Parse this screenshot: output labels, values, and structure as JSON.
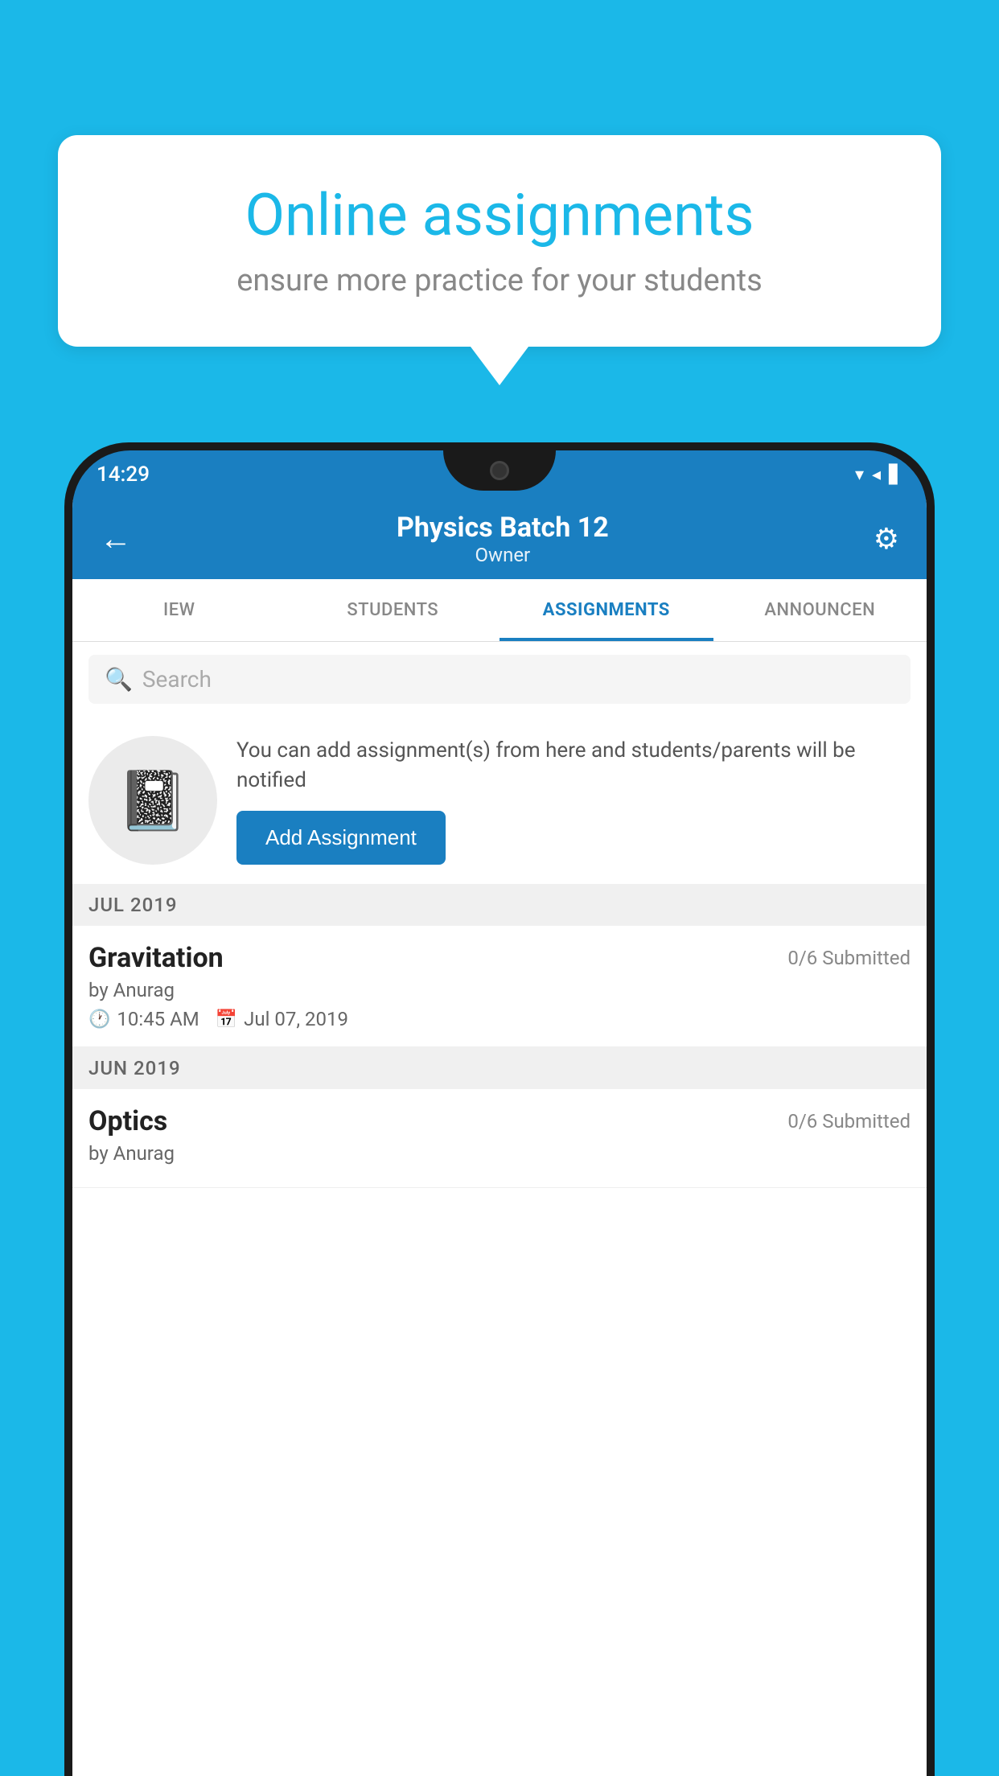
{
  "background_color": "#1BB8E8",
  "speech_bubble": {
    "title": "Online assignments",
    "subtitle": "ensure more practice for your students"
  },
  "status_bar": {
    "time": "14:29",
    "signal_icons": "▼◀█"
  },
  "app_bar": {
    "title": "Physics Batch 12",
    "subtitle": "Owner",
    "back_label": "←",
    "settings_label": "⚙"
  },
  "tabs": [
    {
      "id": "view",
      "label": "IEW",
      "active": false
    },
    {
      "id": "students",
      "label": "STUDENTS",
      "active": false
    },
    {
      "id": "assignments",
      "label": "ASSIGNMENTS",
      "active": true
    },
    {
      "id": "announcements",
      "label": "ANNOUNCEN",
      "active": false
    }
  ],
  "search": {
    "placeholder": "Search"
  },
  "info_section": {
    "description": "You can add assignment(s) from here and students/parents will be notified",
    "add_button_label": "Add Assignment"
  },
  "sections": [
    {
      "header": "JUL 2019",
      "assignments": [
        {
          "name": "Gravitation",
          "submitted": "0/6 Submitted",
          "by": "by Anurag",
          "time": "10:45 AM",
          "date": "Jul 07, 2019"
        }
      ]
    },
    {
      "header": "JUN 2019",
      "assignments": [
        {
          "name": "Optics",
          "submitted": "0/6 Submitted",
          "by": "by Anurag",
          "time": "",
          "date": ""
        }
      ]
    }
  ]
}
